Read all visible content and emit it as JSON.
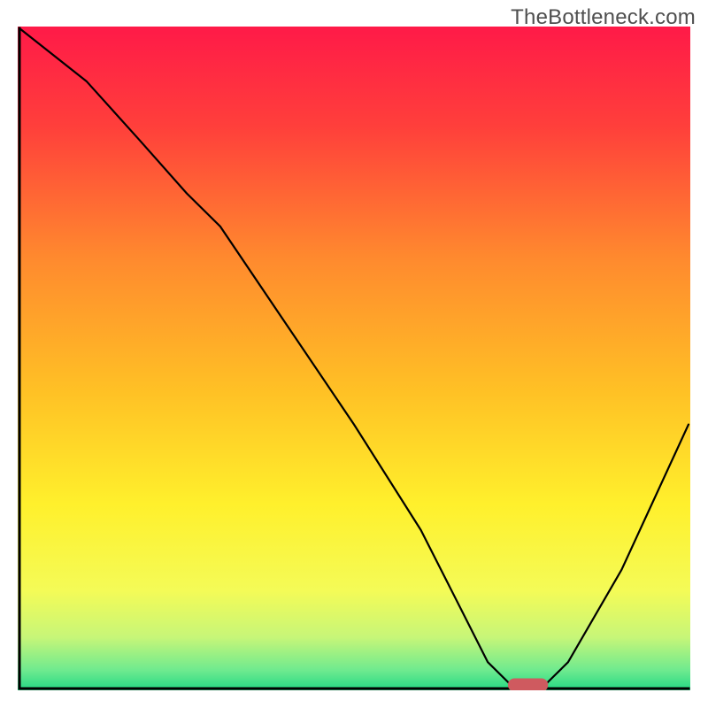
{
  "watermark": "TheBottleneck.com",
  "chart_data": {
    "type": "line",
    "title": "",
    "xlabel": "",
    "ylabel": "",
    "xlim": [
      0,
      100
    ],
    "ylim": [
      0,
      100
    ],
    "grid": false,
    "legend": false,
    "background": {
      "kind": "vertical-gradient",
      "stops": [
        {
          "offset": 0.0,
          "color": "#ff1a48"
        },
        {
          "offset": 0.15,
          "color": "#ff3f3b"
        },
        {
          "offset": 0.35,
          "color": "#ff8a2e"
        },
        {
          "offset": 0.55,
          "color": "#ffc125"
        },
        {
          "offset": 0.72,
          "color": "#fff02c"
        },
        {
          "offset": 0.85,
          "color": "#f4fb57"
        },
        {
          "offset": 0.92,
          "color": "#c7f678"
        },
        {
          "offset": 0.97,
          "color": "#6eea8f"
        },
        {
          "offset": 1.0,
          "color": "#23d884"
        }
      ]
    },
    "series": [
      {
        "name": "bottleneck-curve",
        "color": "#000000",
        "x": [
          0,
          10,
          18,
          25,
          30,
          40,
          50,
          60,
          66,
          70,
          74,
          78,
          82,
          90,
          100
        ],
        "y": [
          100,
          92,
          83,
          75,
          70,
          55,
          40,
          24,
          12,
          4,
          0,
          0,
          4,
          18,
          40
        ]
      }
    ],
    "marker": {
      "name": "optimal-range",
      "shape": "rounded-rect",
      "color": "#cf5a5f",
      "x_center": 76,
      "y_center": 0,
      "width": 6,
      "height": 2
    },
    "axes": {
      "color": "#000000",
      "line_width": 3,
      "ticks": false
    }
  }
}
